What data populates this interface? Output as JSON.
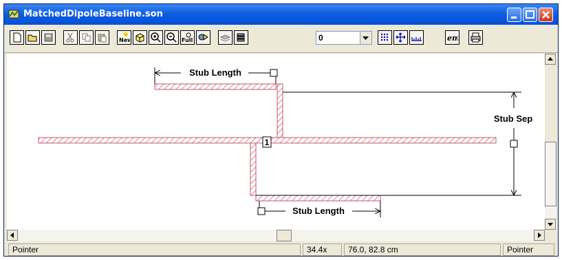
{
  "window": {
    "title": "MatchedDipoleBaseline.son"
  },
  "toolbar": {
    "buttons": [
      "new-file",
      "open",
      "save",
      "cut",
      "copy",
      "paste",
      "new",
      "edit-3d",
      "zoom-in",
      "zoom-out",
      "zoom-full",
      "view-3d",
      "layers",
      "stack",
      "grid",
      "move",
      "ruler",
      "em",
      "print"
    ],
    "level_select": {
      "value": "0"
    }
  },
  "canvas": {
    "labels": {
      "stub_length_top": "Stub Length",
      "stub_sep": "Stub Sep",
      "stub_length_bottom": "Stub Length",
      "port": "1"
    },
    "colors": {
      "metal_hatch": "#c4566b",
      "dimension": "#000000"
    }
  },
  "status": {
    "mode_left": "Pointer",
    "zoom": "34.4x",
    "coords": "76.0, 82.8 cm",
    "mode_right": "Pointer"
  }
}
